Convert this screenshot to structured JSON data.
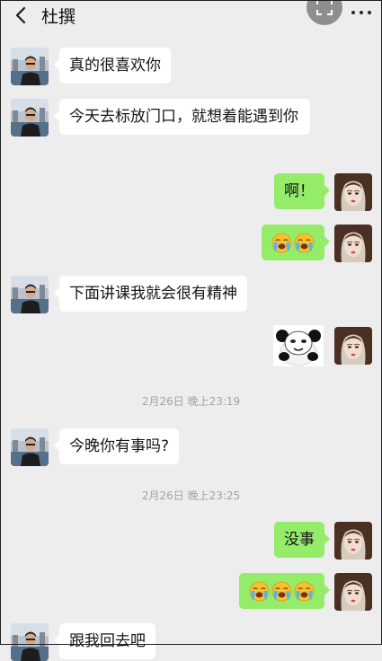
{
  "header": {
    "title": "杜撰"
  },
  "messages": {
    "m1": "真的很喜欢你",
    "m2": "今天去标放门口，就想着能遇到你",
    "m3": "啊！",
    "m5": "下面讲课我就会很有精神",
    "m7": "今晚你有事吗?",
    "m8": "没事",
    "m10": "跟我回去吧"
  },
  "timestamps": {
    "t1": "2月26日 晚上23:19",
    "t2": "2月26日 晚上23:25"
  },
  "colors": {
    "background": "#ededed",
    "incoming_bubble": "#ffffff",
    "outgoing_bubble": "#95ec69"
  },
  "icons": {
    "back": "chevron-left-icon",
    "capture": "screen-capture-icon",
    "more": "more-dots-icon",
    "emoji": "loudly-crying-face",
    "sticker": "panda-face-sticker"
  }
}
